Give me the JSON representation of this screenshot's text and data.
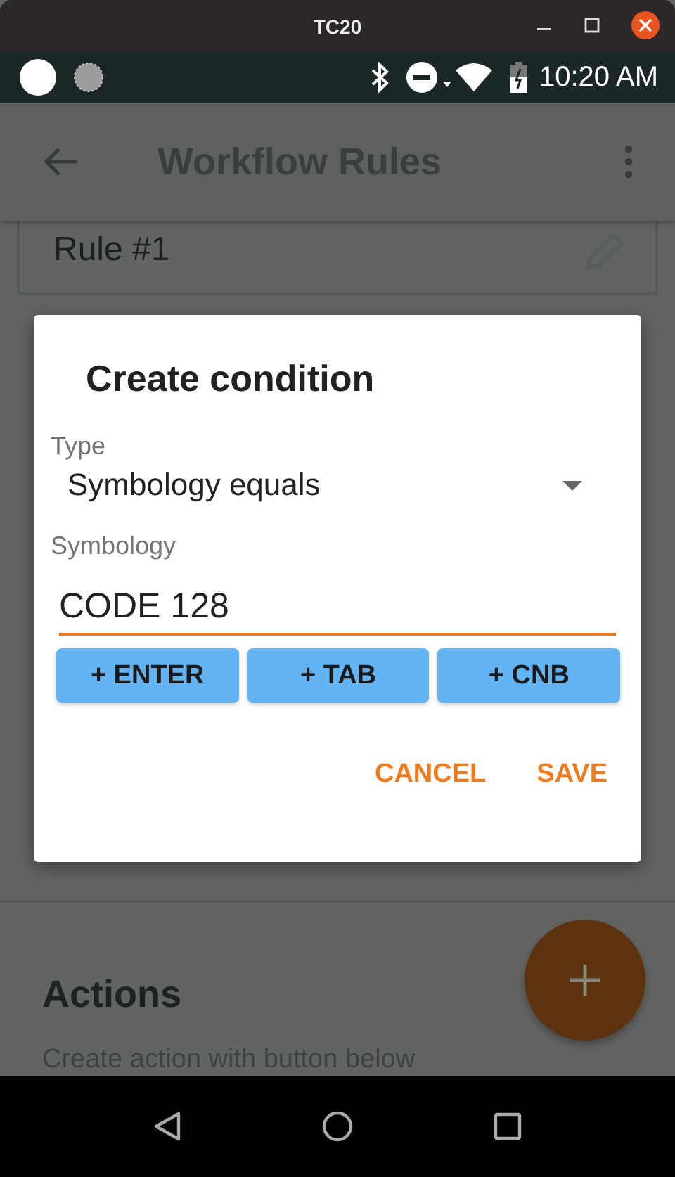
{
  "window": {
    "title": "TC20"
  },
  "status_bar": {
    "time": "10:20 AM"
  },
  "app_bar": {
    "title": "Workflow Rules"
  },
  "rule": {
    "name": "Rule #1"
  },
  "actions_section": {
    "heading": "Actions",
    "hint": "Create action with button below"
  },
  "dialog": {
    "title": "Create condition",
    "type_field": {
      "label": "Type",
      "value": "Symbology equals"
    },
    "symbology_field": {
      "label": "Symbology",
      "value": "CODE 128"
    },
    "chips": [
      {
        "label": "+ ENTER"
      },
      {
        "label": "+ TAB"
      },
      {
        "label": "+ CNB"
      }
    ],
    "buttons": [
      {
        "label": "CANCEL"
      },
      {
        "label": "SAVE"
      }
    ]
  }
}
